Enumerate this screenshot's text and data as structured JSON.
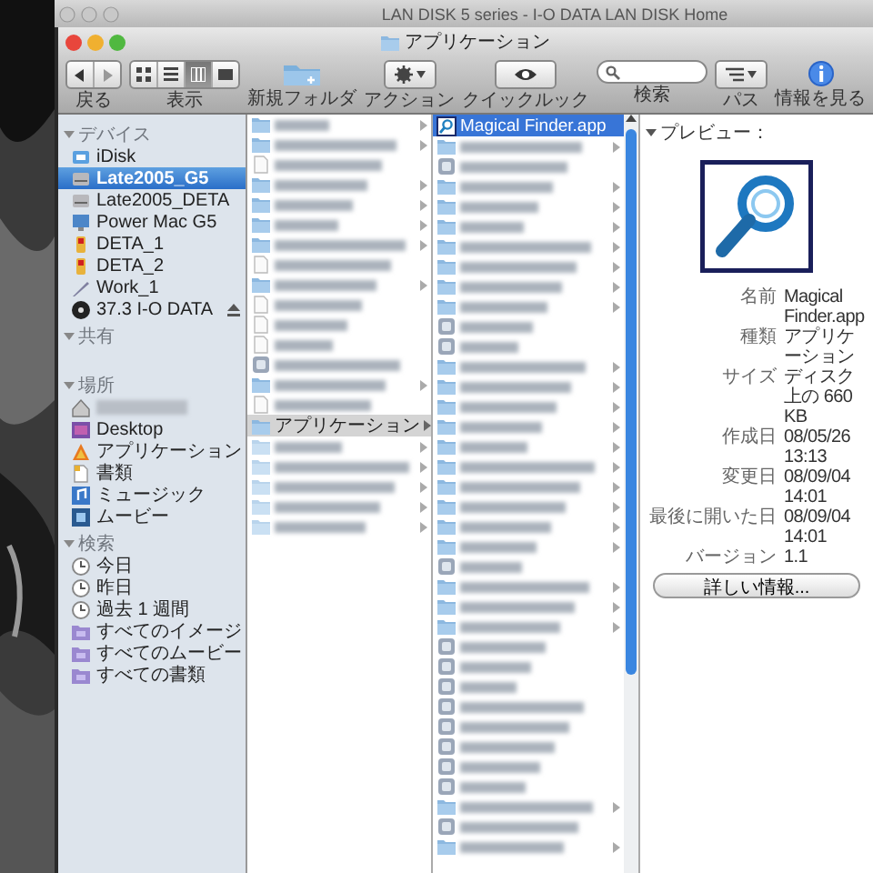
{
  "background_window": {
    "title": "LAN DISK 5 series - I-O DATA LAN DISK Home"
  },
  "window": {
    "title": "アプリケーション"
  },
  "toolbar": [
    {
      "kind": "nav",
      "label": "戻る"
    },
    {
      "kind": "view",
      "label": "表示",
      "modes": [
        {
          "selected": false
        },
        {
          "selected": false
        },
        {
          "selected": true
        },
        {
          "selected": false
        }
      ]
    },
    {
      "kind": "new-folder",
      "label": "新規フォルダ"
    },
    {
      "kind": "action",
      "label": "アクション"
    },
    {
      "kind": "quicklook",
      "label": "クイックルック"
    },
    {
      "kind": "search",
      "label": "検索"
    },
    {
      "kind": "path",
      "label": "パス"
    },
    {
      "kind": "info",
      "label": "情報を見る"
    }
  ],
  "sidebar": {
    "sections": [
      {
        "title": "デバイス",
        "expanded": true,
        "items": [
          {
            "kind": "idisk",
            "label": "iDisk",
            "selected": false,
            "ejectable": false
          },
          {
            "kind": "drive",
            "label": "Late2005_G5",
            "selected": true,
            "ejectable": false
          },
          {
            "kind": "drive",
            "label": "Late2005_DETA",
            "selected": false,
            "ejectable": false
          },
          {
            "kind": "mac",
            "label": "Power Mac G5",
            "selected": false,
            "ejectable": false
          },
          {
            "kind": "usb",
            "label": "DETA_1",
            "selected": false,
            "ejectable": false
          },
          {
            "kind": "usb",
            "label": "DETA_2",
            "selected": false,
            "ejectable": false
          },
          {
            "kind": "pen",
            "label": "Work_1",
            "selected": false,
            "ejectable": false
          },
          {
            "kind": "disc",
            "label": "37.3 I-O DATA",
            "selected": false,
            "ejectable": true
          }
        ]
      },
      {
        "title": "共有",
        "expanded": true
      },
      {
        "title": "場所",
        "expanded": true,
        "items": [
          {
            "kind": "home",
            "selected": false,
            "ejectable": false
          },
          {
            "kind": "desktop",
            "label": "Desktop",
            "selected": false,
            "ejectable": false
          },
          {
            "kind": "apps",
            "label": "アプリケーション",
            "selected": false,
            "ejectable": false
          },
          {
            "kind": "docs",
            "label": "書類",
            "selected": false,
            "ejectable": false
          },
          {
            "kind": "music",
            "label": "ミュージック",
            "selected": false,
            "ejectable": false
          },
          {
            "kind": "movies",
            "label": "ムービー",
            "selected": false,
            "ejectable": false
          }
        ]
      },
      {
        "title": "検索",
        "expanded": true,
        "items": [
          {
            "kind": "clock",
            "label": "今日",
            "selected": false,
            "ejectable": false
          },
          {
            "kind": "clock",
            "label": "昨日",
            "selected": false,
            "ejectable": false
          },
          {
            "kind": "clock",
            "label": "過去 1 週間",
            "selected": false,
            "ejectable": false
          },
          {
            "kind": "smart",
            "label": "すべてのイメージ",
            "selected": false,
            "ejectable": false
          },
          {
            "kind": "smart",
            "label": "すべてのムービー",
            "selected": false,
            "ejectable": false
          },
          {
            "kind": "smart",
            "label": "すべての書類",
            "selected": false,
            "ejectable": false
          }
        ]
      }
    ]
  },
  "columns": [
    {
      "rows": [
        {
          "kind": "folder",
          "selected": false
        },
        {
          "kind": "folder",
          "selected": false
        },
        {
          "kind": "file",
          "selected": false
        },
        {
          "kind": "folder",
          "selected": false
        },
        {
          "kind": "folder",
          "selected": false
        },
        {
          "kind": "folder",
          "selected": false
        },
        {
          "kind": "folder",
          "selected": false
        },
        {
          "kind": "file",
          "selected": false
        },
        {
          "kind": "folder",
          "selected": false
        },
        {
          "kind": "file",
          "selected": false
        },
        {
          "kind": "file",
          "selected": false
        },
        {
          "kind": "file",
          "selected": false
        },
        {
          "kind": "app",
          "selected": false
        },
        {
          "kind": "folder",
          "selected": false
        },
        {
          "kind": "file",
          "selected": false
        },
        {
          "kind": "folder",
          "label": "アプリケーション",
          "selected": true
        },
        {
          "kind": "folder",
          "selected": false
        },
        {
          "kind": "folder",
          "selected": false
        },
        {
          "kind": "folder",
          "selected": false
        },
        {
          "kind": "folder",
          "selected": false
        },
        {
          "kind": "folder",
          "selected": false
        }
      ]
    },
    {
      "rows": [
        {
          "kind": "app",
          "label": "Magical Finder.app",
          "selected": true
        },
        {
          "kind": "folder",
          "selected": false
        },
        {
          "kind": "app",
          "selected": false
        },
        {
          "kind": "folder",
          "selected": false
        },
        {
          "kind": "folder",
          "selected": false
        },
        {
          "kind": "folder",
          "selected": false
        },
        {
          "kind": "folder",
          "selected": false
        },
        {
          "kind": "folder",
          "selected": false
        },
        {
          "kind": "folder",
          "selected": false
        },
        {
          "kind": "folder",
          "selected": false
        },
        {
          "kind": "app",
          "selected": false
        },
        {
          "kind": "app",
          "selected": false
        },
        {
          "kind": "folder",
          "selected": false
        },
        {
          "kind": "folder",
          "selected": false
        },
        {
          "kind": "folder",
          "selected": false
        },
        {
          "kind": "folder",
          "selected": false
        },
        {
          "kind": "folder",
          "selected": false
        },
        {
          "kind": "folder",
          "selected": false
        },
        {
          "kind": "folder",
          "selected": false
        },
        {
          "kind": "folder",
          "selected": false
        },
        {
          "kind": "folder",
          "selected": false
        },
        {
          "kind": "folder",
          "selected": false
        },
        {
          "kind": "app",
          "selected": false
        },
        {
          "kind": "folder",
          "selected": false
        },
        {
          "kind": "folder",
          "selected": false
        },
        {
          "kind": "folder",
          "selected": false
        },
        {
          "kind": "app",
          "selected": false
        },
        {
          "kind": "app",
          "selected": false
        },
        {
          "kind": "app",
          "selected": false
        },
        {
          "kind": "app",
          "selected": false
        },
        {
          "kind": "app",
          "selected": false
        },
        {
          "kind": "app",
          "selected": false
        },
        {
          "kind": "app",
          "selected": false
        },
        {
          "kind": "app",
          "selected": false
        },
        {
          "kind": "folder",
          "selected": false
        },
        {
          "kind": "app",
          "selected": false
        },
        {
          "kind": "folder",
          "selected": false
        }
      ]
    }
  ],
  "preview": {
    "title": "プレビュー：",
    "expanded": true,
    "fields": [
      {
        "label": "名前",
        "value": "Magical Finder.app"
      },
      {
        "label": "種類",
        "value": "アプリケーション"
      },
      {
        "label": "サイズ",
        "value": "ディスク上の 660 KB"
      },
      {
        "label": "作成日",
        "value": "08/05/26 13:13"
      },
      {
        "label": "変更日",
        "value": "08/09/04 14:01"
      },
      {
        "label": "最後に開いた日",
        "value": "08/09/04 14:01"
      },
      {
        "label": "バージョン",
        "value": "1.1"
      }
    ],
    "button": "詳しい情報..."
  }
}
